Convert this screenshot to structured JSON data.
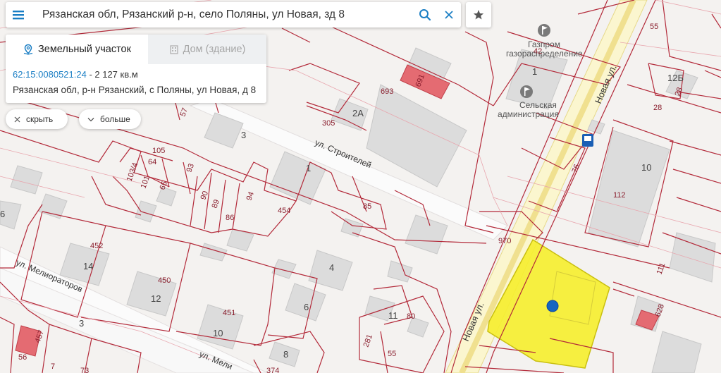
{
  "search": {
    "value": "Рязанская обл, Рязанский р-н, село Поляны, ул Новая, зд 8"
  },
  "card": {
    "tab_active": "Земельный участок",
    "tab_inactive": "Дом (здание)",
    "cadastral_number": "62:15:0080521:24",
    "area": " - 2 127 кв.м",
    "address": "Рязанская обл, р-н Рязанский, с Поляны, ул Новая, д 8"
  },
  "chips": {
    "hide": "скрыть",
    "more": "больше"
  },
  "map": {
    "poi": {
      "gazprom_line1": "Газпром",
      "gazprom_line2": "газораспределение",
      "admin_line1": "Сельская",
      "admin_line2": "администрация"
    },
    "streets": {
      "novaya_top": "Новая ул.",
      "novaya_bottom": "Новая ул.",
      "stroiteley": "ул. Строителей",
      "melioratorov": "ул. Мелиораторов",
      "melio_bottom": "ул. Мели"
    },
    "house_numbers": {
      "h1": "1",
      "h2a": "2А",
      "h3": "3",
      "h4": "4",
      "h6": "6",
      "h6b": "6",
      "h8": "8",
      "h10": "10",
      "h10b": "10",
      "h11": "11",
      "h12": "12",
      "h12b": "12Б",
      "h14": "14",
      "h1b": "1",
      "h3b": "3"
    },
    "parcel_numbers": {
      "p55": "55",
      "p42": "42",
      "p693": "693",
      "p691": "691",
      "p305": "305",
      "p57": "57",
      "p105": "105",
      "p64": "64",
      "p93": "93",
      "p103_4": "103/4",
      "p101": "101",
      "p65": "65",
      "p90": "90",
      "p89": "89",
      "p86": "86",
      "p94": "94",
      "p454": "454",
      "p85": "85",
      "p76": "76",
      "p112": "112",
      "p970": "970",
      "p28": "28",
      "p28b": "28",
      "p111": "111",
      "p452": "452",
      "p450": "450",
      "p451": "451",
      "p80": "80",
      "p281": "281",
      "p55b": "55",
      "p628": "628",
      "p457": "457",
      "p56": "56",
      "p7": "7",
      "p73": "73",
      "p374": "374"
    }
  },
  "colors": {
    "accent": "#1a7ec4",
    "parcel_line": "#b32a3a",
    "selected_parcel": "#f5ee2a",
    "marker": "#1565c0",
    "building": "#d9d9d9",
    "highlight_building": "#e06a6f"
  },
  "icons": {
    "menu": "hamburger-menu-icon",
    "search": "search-icon",
    "clear": "close-icon",
    "star": "star-icon",
    "parcel": "location-pin-icon",
    "building": "building-icon",
    "hide": "close-icon",
    "more": "chevron-down-icon"
  }
}
